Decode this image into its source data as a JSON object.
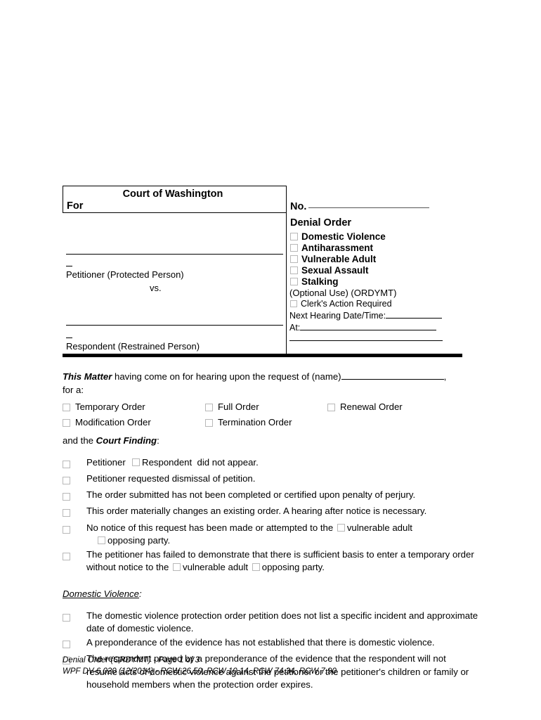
{
  "caption": {
    "court_title": "Court of Washington",
    "for_label": "For",
    "petitioner_label": "Petitioner (Protected Person)",
    "vs_label": "vs.",
    "respondent_label": "Respondent (Restrained Person)",
    "case_no_label": "No.",
    "denial_order_title": "Denial Order",
    "order_types": [
      "Domestic Violence",
      "Antiharassment",
      "Vulnerable Adult",
      "Sexual Assault",
      "Stalking"
    ],
    "optional_use": "(Optional Use) (ORDYMT)",
    "clerks_action": "Clerk's Action Required",
    "next_hearing_label": "Next Hearing Date/Time:",
    "at_label": "At:"
  },
  "body": {
    "matter_lead": "This Matter",
    "matter_text": " having come on for hearing upon the request of (name)",
    "matter_comma": ",",
    "for_a": "for a:",
    "order_options": [
      {
        "label": "Temporary Order",
        "col": 0,
        "row": 0
      },
      {
        "label": "Full Order",
        "col": 1,
        "row": 0
      },
      {
        "label": "Renewal Order",
        "col": 2,
        "row": 0
      },
      {
        "label": "Modification Order",
        "col": 0,
        "row": 1
      },
      {
        "label": "Termination Order",
        "col": 1,
        "row": 1
      }
    ],
    "and_the": "and the ",
    "court_finding": "Court Finding",
    "colon": ":",
    "findings": [
      {
        "type": "appear",
        "petitioner": "Petitioner",
        "respondent": "Respondent",
        "tail": "did not appear."
      },
      {
        "type": "plain",
        "text": "Petitioner requested dismissal of petition."
      },
      {
        "type": "plain",
        "text": "The order submitted has not been completed or certified upon penalty of perjury."
      },
      {
        "type": "plain",
        "text": "This order materially changes an existing order. A hearing after notice is necessary."
      },
      {
        "type": "notice",
        "part1": "No notice of this request has been made or attempted to the",
        "opt1": "vulnerable adult",
        "opt2": "opposing party."
      },
      {
        "type": "failed",
        "part1": "The petitioner has failed to demonstrate that there is sufficient basis to enter a temporary order without notice to the",
        "opt1": "vulnerable adult",
        "opt2": "opposing party."
      }
    ],
    "dv_heading": "Domestic Violence",
    "dv_heading_colon": ":",
    "dv_findings": [
      "The domestic violence protection order petition does not list a specific incident and approximate date of domestic violence.",
      "A preponderance of the evidence has not established that there is domestic violence.",
      "The respondent proved by a preponderance of the evidence that the respondent will not resume acts of domestic violence against the petitioner or the petitioner's children or family or household members when the protection order expires."
    ]
  },
  "footer": {
    "line1": "Denial Order (ORDYMT) - Page 1 of 3",
    "line2": "WPF DV-6.020 (12/2014) - RCW 26.50, RCW 10.14, RCW 74.34, RCW 7.90"
  }
}
